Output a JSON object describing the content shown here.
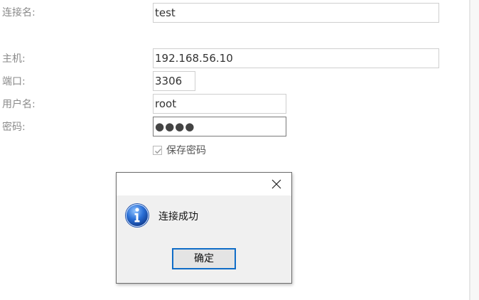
{
  "form": {
    "connection_name": {
      "label": "连接名:",
      "value": "test"
    },
    "host": {
      "label": "主机:",
      "value": "192.168.56.10"
    },
    "port": {
      "label": "端口:",
      "value": "3306"
    },
    "username": {
      "label": "用户名:",
      "value": "root"
    },
    "password": {
      "label": "密码:",
      "value": "●●●●"
    },
    "save_password": {
      "label": "保存密码",
      "checked": true
    }
  },
  "dialog": {
    "icon": "info-icon",
    "message": "连接成功",
    "ok_label": "确定",
    "close_icon": "close-icon"
  },
  "colors": {
    "accent": "#0f6cc7",
    "dialog_bg": "#f0f0f0",
    "label_text": "#8a8a8a"
  }
}
